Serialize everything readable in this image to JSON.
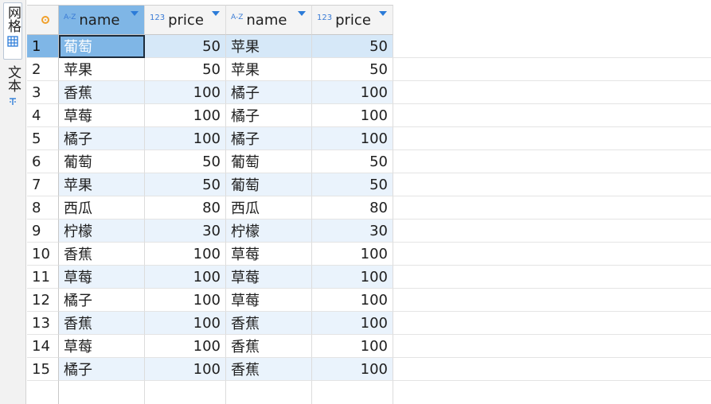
{
  "sidebar": {
    "grid_tab_label": "网格",
    "text_tab_label": "文本"
  },
  "columns": [
    {
      "type_badge": "A-Z",
      "label": "name"
    },
    {
      "type_badge": "123",
      "label": "price"
    },
    {
      "type_badge": "A-Z",
      "label": "name"
    },
    {
      "type_badge": "123",
      "label": "price"
    }
  ],
  "rows": [
    {
      "num": "1",
      "name1": "葡萄",
      "price1": "50",
      "name2": "苹果",
      "price2": "50"
    },
    {
      "num": "2",
      "name1": "苹果",
      "price1": "50",
      "name2": "苹果",
      "price2": "50"
    },
    {
      "num": "3",
      "name1": "香蕉",
      "price1": "100",
      "name2": "橘子",
      "price2": "100"
    },
    {
      "num": "4",
      "name1": "草莓",
      "price1": "100",
      "name2": "橘子",
      "price2": "100"
    },
    {
      "num": "5",
      "name1": "橘子",
      "price1": "100",
      "name2": "橘子",
      "price2": "100"
    },
    {
      "num": "6",
      "name1": "葡萄",
      "price1": "50",
      "name2": "葡萄",
      "price2": "50"
    },
    {
      "num": "7",
      "name1": "苹果",
      "price1": "50",
      "name2": "葡萄",
      "price2": "50"
    },
    {
      "num": "8",
      "name1": "西瓜",
      "price1": "80",
      "name2": "西瓜",
      "price2": "80"
    },
    {
      "num": "9",
      "name1": "柠檬",
      "price1": "30",
      "name2": "柠檬",
      "price2": "30"
    },
    {
      "num": "10",
      "name1": "香蕉",
      "price1": "100",
      "name2": "草莓",
      "price2": "100"
    },
    {
      "num": "11",
      "name1": "草莓",
      "price1": "100",
      "name2": "草莓",
      "price2": "100"
    },
    {
      "num": "12",
      "name1": "橘子",
      "price1": "100",
      "name2": "草莓",
      "price2": "100"
    },
    {
      "num": "13",
      "name1": "香蕉",
      "price1": "100",
      "name2": "香蕉",
      "price2": "100"
    },
    {
      "num": "14",
      "name1": "草莓",
      "price1": "100",
      "name2": "香蕉",
      "price2": "100"
    },
    {
      "num": "15",
      "name1": "橘子",
      "price1": "100",
      "name2": "香蕉",
      "price2": "100"
    }
  ],
  "colors": {
    "selection": "#7fb6e6",
    "row_alt": "#eaf3fc",
    "accent": "#2b7bd8"
  }
}
